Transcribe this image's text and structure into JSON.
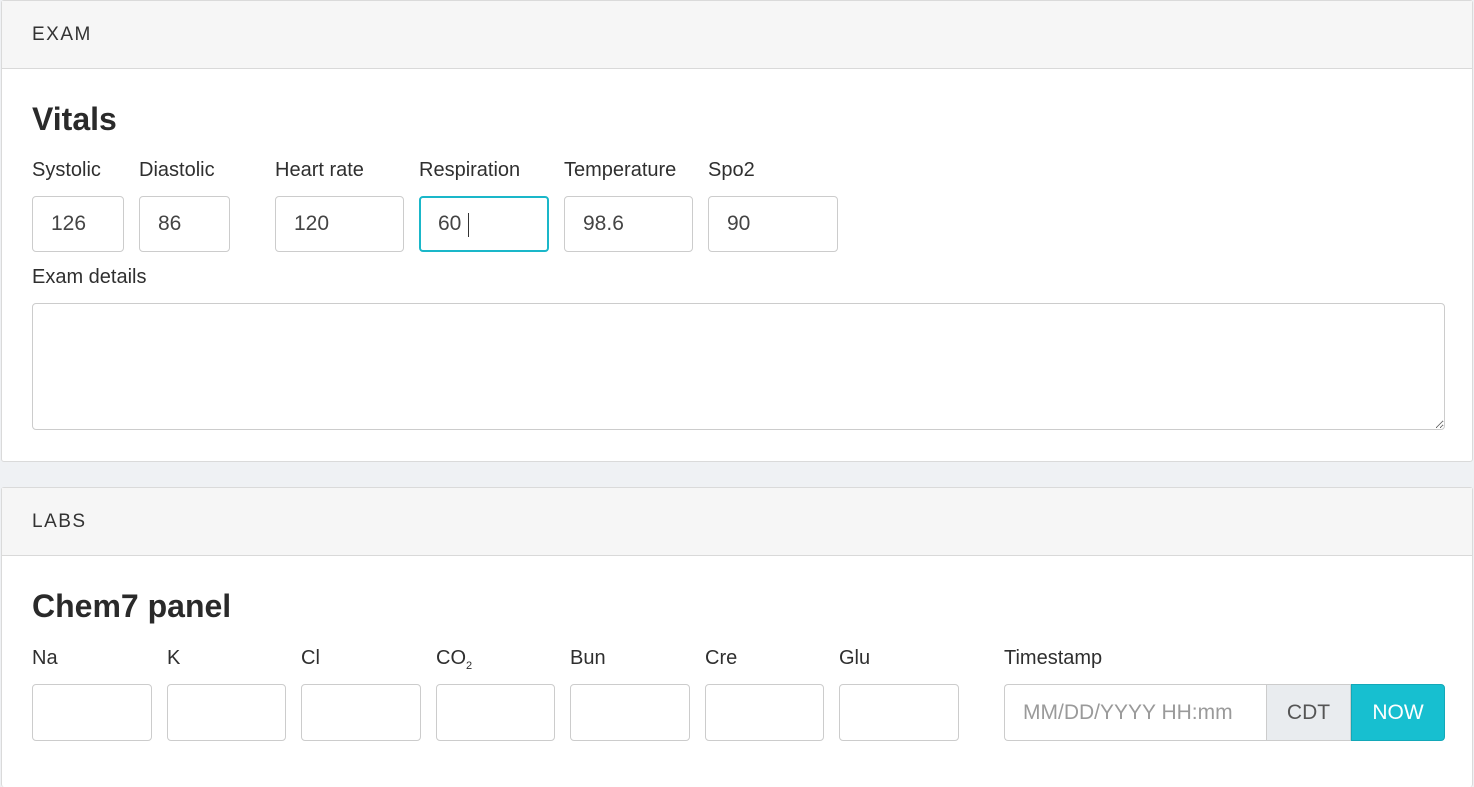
{
  "exam": {
    "header": "EXAM",
    "title": "Vitals",
    "fields": [
      {
        "label": "Systolic",
        "value": "126"
      },
      {
        "label": "Diastolic",
        "value": "86"
      },
      {
        "label": "Heart rate",
        "value": "120"
      },
      {
        "label": "Respiration",
        "value": "60"
      },
      {
        "label": "Temperature",
        "value": "98.6"
      },
      {
        "label": "Spo2",
        "value": "90"
      }
    ],
    "details_label": "Exam details",
    "details_value": ""
  },
  "labs": {
    "header": "LABS",
    "title": "Chem7 panel",
    "fields": [
      {
        "label": "Na",
        "value": ""
      },
      {
        "label": "K",
        "value": ""
      },
      {
        "label": "Cl",
        "value": ""
      },
      {
        "label": "CO",
        "sub": "2",
        "value": ""
      },
      {
        "label": "Bun",
        "value": ""
      },
      {
        "label": "Cre",
        "value": ""
      },
      {
        "label": "Glu",
        "value": ""
      }
    ],
    "timestamp": {
      "label": "Timestamp",
      "placeholder": "MM/DD/YYYY HH:mm",
      "timezone": "CDT",
      "now_label": "NOW"
    }
  },
  "colors": {
    "accent": "#17bfd0",
    "focus_border": "#1ab7c9"
  }
}
